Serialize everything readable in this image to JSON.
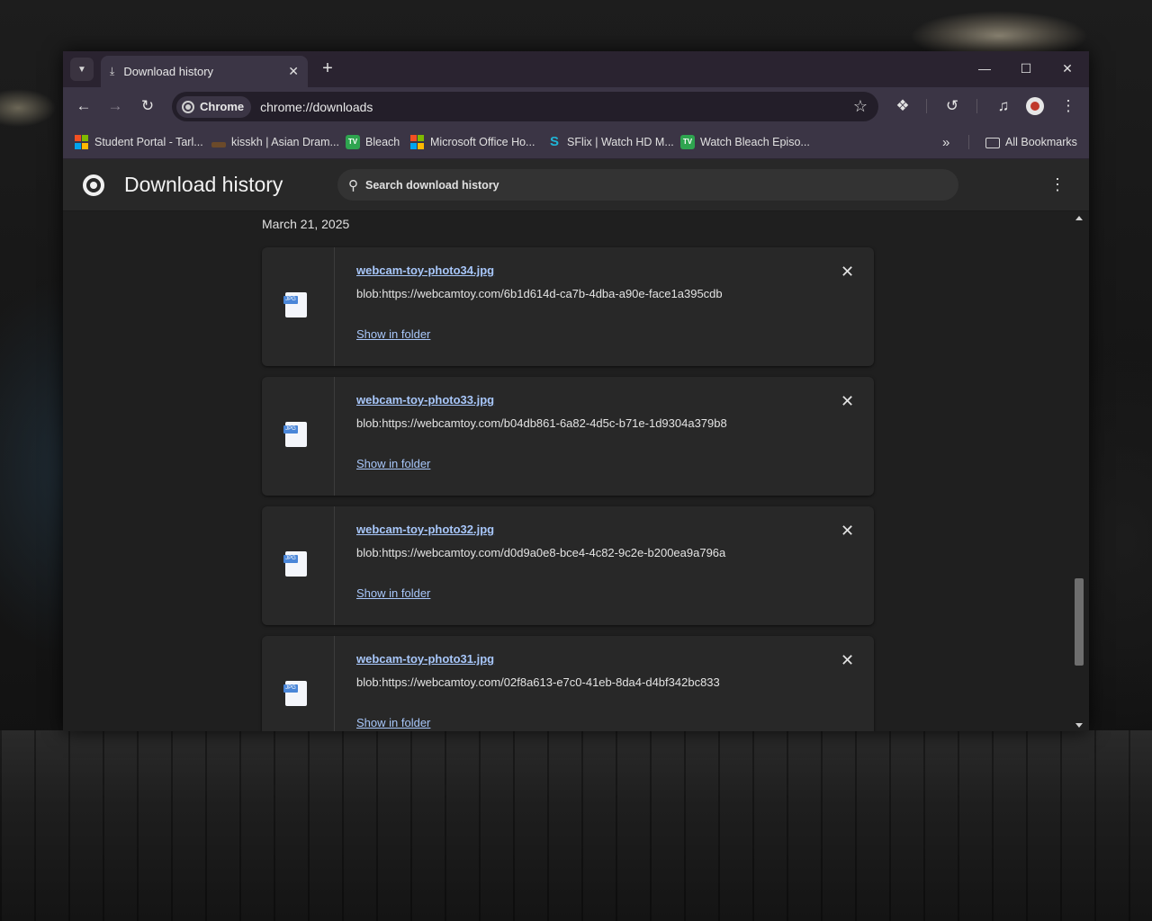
{
  "tabstrip": {
    "tab_title": "Download history"
  },
  "toolbar": {
    "chip_label": "Chrome",
    "url": "chrome://downloads"
  },
  "bookmarks": [
    {
      "label": "Student Portal - Tarl...",
      "icon": "microsoft-icon"
    },
    {
      "label": "kisskh | Asian Dram...",
      "icon": "kisskh-icon"
    },
    {
      "label": "Bleach",
      "icon": "tv-icon"
    },
    {
      "label": "Microsoft Office Ho...",
      "icon": "microsoft-icon"
    },
    {
      "label": "SFlix | Watch HD M...",
      "icon": "sflix-icon"
    },
    {
      "label": "Watch Bleach Episo...",
      "icon": "tv-icon"
    }
  ],
  "all_bookmarks_label": "All Bookmarks",
  "page": {
    "title": "Download history",
    "search_placeholder": "Search download history",
    "date_heading": "March 21, 2025"
  },
  "downloads": [
    {
      "name": "webcam-toy-photo34.jpg",
      "url": "blob:https://webcamtoy.com/6b1d614d-ca7b-4dba-a90e-face1a395cdb",
      "action": "Show in folder"
    },
    {
      "name": "webcam-toy-photo33.jpg",
      "url": "blob:https://webcamtoy.com/b04db861-6a82-4d5c-b71e-1d9304a379b8",
      "action": "Show in folder"
    },
    {
      "name": "webcam-toy-photo32.jpg",
      "url": "blob:https://webcamtoy.com/d0d9a0e8-bce4-4c82-9c2e-b200ea9a796a",
      "action": "Show in folder"
    },
    {
      "name": "webcam-toy-photo31.jpg",
      "url": "blob:https://webcamtoy.com/02f8a613-e7c0-41eb-8da4-d4bf342bc833",
      "action": "Show in folder"
    }
  ],
  "colors": {
    "link": "#a8c7fa",
    "frame": "#2a2330",
    "toolbar": "#3b3545",
    "page_bg": "#1f1f1f",
    "card_bg": "#282828"
  }
}
